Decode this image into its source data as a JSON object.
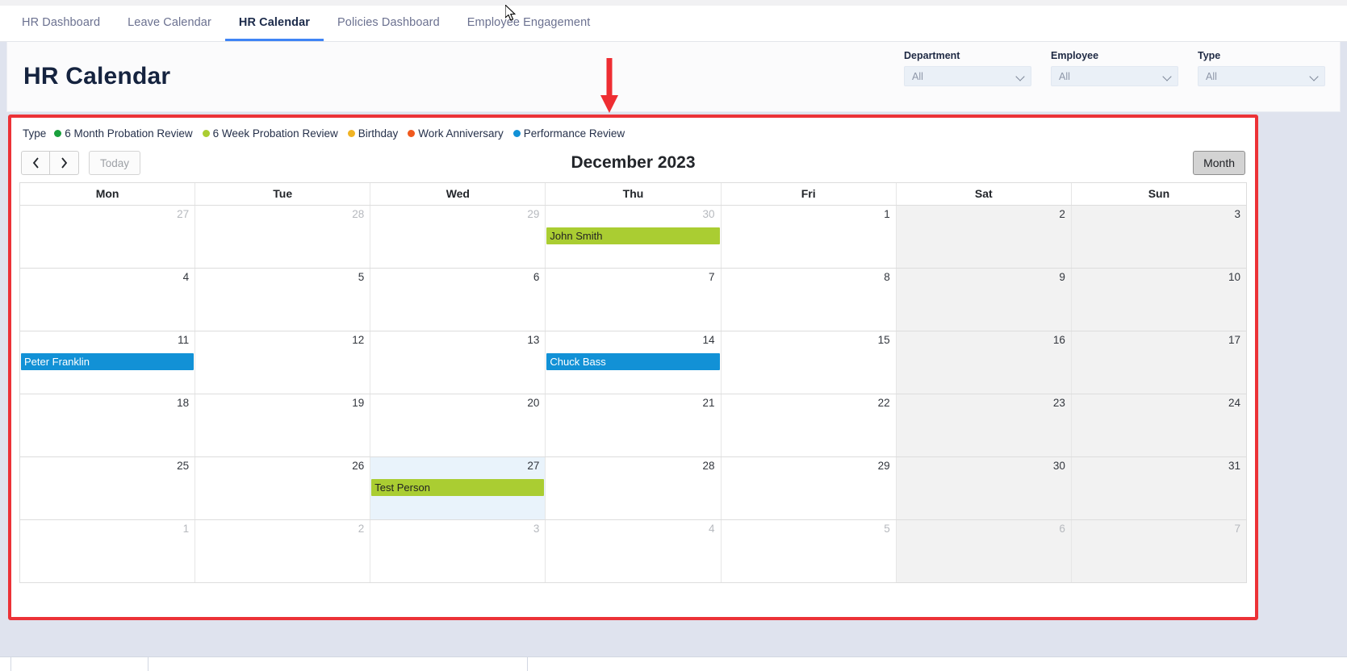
{
  "nav": {
    "tabs": [
      {
        "label": "HR Dashboard",
        "active": false
      },
      {
        "label": "Leave Calendar",
        "active": false
      },
      {
        "label": "HR Calendar",
        "active": true
      },
      {
        "label": "Policies Dashboard",
        "active": false
      },
      {
        "label": "Employee Engagement",
        "active": false
      }
    ]
  },
  "header": {
    "title": "HR Calendar",
    "filters": [
      {
        "label": "Department",
        "value": "All"
      },
      {
        "label": "Employee",
        "value": "All"
      },
      {
        "label": "Type",
        "value": "All"
      }
    ]
  },
  "legend": {
    "title": "Type",
    "items": [
      {
        "label": "6 Month Probation Review",
        "color": "#19a03c"
      },
      {
        "label": "6 Week Probation Review",
        "color": "#aacd32"
      },
      {
        "label": "Birthday",
        "color": "#f0b323"
      },
      {
        "label": "Work Anniversary",
        "color": "#f0591e"
      },
      {
        "label": "Performance Review",
        "color": "#1291d6"
      }
    ]
  },
  "toolbar": {
    "prev_label": "‹",
    "next_label": "›",
    "today_label": "Today",
    "calendar_title": "December 2023",
    "view_label": "Month"
  },
  "calendar": {
    "weekdays": [
      "Mon",
      "Tue",
      "Wed",
      "Thu",
      "Fri",
      "Sat",
      "Sun"
    ],
    "weeks": [
      [
        {
          "num": "27",
          "other": true,
          "weekend": false,
          "today": false,
          "events": []
        },
        {
          "num": "28",
          "other": true,
          "weekend": false,
          "today": false,
          "events": []
        },
        {
          "num": "29",
          "other": true,
          "weekend": false,
          "today": false,
          "events": []
        },
        {
          "num": "30",
          "other": true,
          "weekend": false,
          "today": false,
          "events": [
            {
              "title": "John Smith",
              "color": "#aacd32",
              "text_color": "#222222"
            }
          ]
        },
        {
          "num": "1",
          "other": false,
          "weekend": false,
          "today": false,
          "events": []
        },
        {
          "num": "2",
          "other": false,
          "weekend": true,
          "today": false,
          "events": []
        },
        {
          "num": "3",
          "other": false,
          "weekend": true,
          "today": false,
          "events": []
        }
      ],
      [
        {
          "num": "4",
          "other": false,
          "weekend": false,
          "today": false,
          "events": []
        },
        {
          "num": "5",
          "other": false,
          "weekend": false,
          "today": false,
          "events": []
        },
        {
          "num": "6",
          "other": false,
          "weekend": false,
          "today": false,
          "events": []
        },
        {
          "num": "7",
          "other": false,
          "weekend": false,
          "today": false,
          "events": []
        },
        {
          "num": "8",
          "other": false,
          "weekend": false,
          "today": false,
          "events": []
        },
        {
          "num": "9",
          "other": false,
          "weekend": true,
          "today": false,
          "events": []
        },
        {
          "num": "10",
          "other": false,
          "weekend": true,
          "today": false,
          "events": []
        }
      ],
      [
        {
          "num": "11",
          "other": false,
          "weekend": false,
          "today": false,
          "events": [
            {
              "title": "Peter Franklin",
              "color": "#1291d6",
              "text_color": "#ffffff"
            }
          ]
        },
        {
          "num": "12",
          "other": false,
          "weekend": false,
          "today": false,
          "events": []
        },
        {
          "num": "13",
          "other": false,
          "weekend": false,
          "today": false,
          "events": []
        },
        {
          "num": "14",
          "other": false,
          "weekend": false,
          "today": false,
          "events": [
            {
              "title": "Chuck Bass",
              "color": "#1291d6",
              "text_color": "#ffffff"
            }
          ]
        },
        {
          "num": "15",
          "other": false,
          "weekend": false,
          "today": false,
          "events": []
        },
        {
          "num": "16",
          "other": false,
          "weekend": true,
          "today": false,
          "events": []
        },
        {
          "num": "17",
          "other": false,
          "weekend": true,
          "today": false,
          "events": []
        }
      ],
      [
        {
          "num": "18",
          "other": false,
          "weekend": false,
          "today": false,
          "events": []
        },
        {
          "num": "19",
          "other": false,
          "weekend": false,
          "today": false,
          "events": []
        },
        {
          "num": "20",
          "other": false,
          "weekend": false,
          "today": false,
          "events": []
        },
        {
          "num": "21",
          "other": false,
          "weekend": false,
          "today": false,
          "events": []
        },
        {
          "num": "22",
          "other": false,
          "weekend": false,
          "today": false,
          "events": []
        },
        {
          "num": "23",
          "other": false,
          "weekend": true,
          "today": false,
          "events": []
        },
        {
          "num": "24",
          "other": false,
          "weekend": true,
          "today": false,
          "events": []
        }
      ],
      [
        {
          "num": "25",
          "other": false,
          "weekend": false,
          "today": false,
          "events": []
        },
        {
          "num": "26",
          "other": false,
          "weekend": false,
          "today": false,
          "events": []
        },
        {
          "num": "27",
          "other": false,
          "weekend": false,
          "today": true,
          "events": [
            {
              "title": "Test Person",
              "color": "#aacd32",
              "text_color": "#222222"
            }
          ]
        },
        {
          "num": "28",
          "other": false,
          "weekend": false,
          "today": false,
          "events": []
        },
        {
          "num": "29",
          "other": false,
          "weekend": false,
          "today": false,
          "events": []
        },
        {
          "num": "30",
          "other": false,
          "weekend": true,
          "today": false,
          "events": []
        },
        {
          "num": "31",
          "other": false,
          "weekend": true,
          "today": false,
          "events": []
        }
      ],
      [
        {
          "num": "1",
          "other": true,
          "weekend": false,
          "today": false,
          "events": []
        },
        {
          "num": "2",
          "other": true,
          "weekend": false,
          "today": false,
          "events": []
        },
        {
          "num": "3",
          "other": true,
          "weekend": false,
          "today": false,
          "events": []
        },
        {
          "num": "4",
          "other": true,
          "weekend": false,
          "today": false,
          "events": []
        },
        {
          "num": "5",
          "other": true,
          "weekend": false,
          "today": false,
          "events": []
        },
        {
          "num": "6",
          "other": true,
          "weekend": true,
          "today": false,
          "events": []
        },
        {
          "num": "7",
          "other": true,
          "weekend": true,
          "today": false,
          "events": []
        }
      ]
    ]
  },
  "annotation": {
    "arrow_color": "#ee2d32",
    "box_color": "#ec3237"
  }
}
